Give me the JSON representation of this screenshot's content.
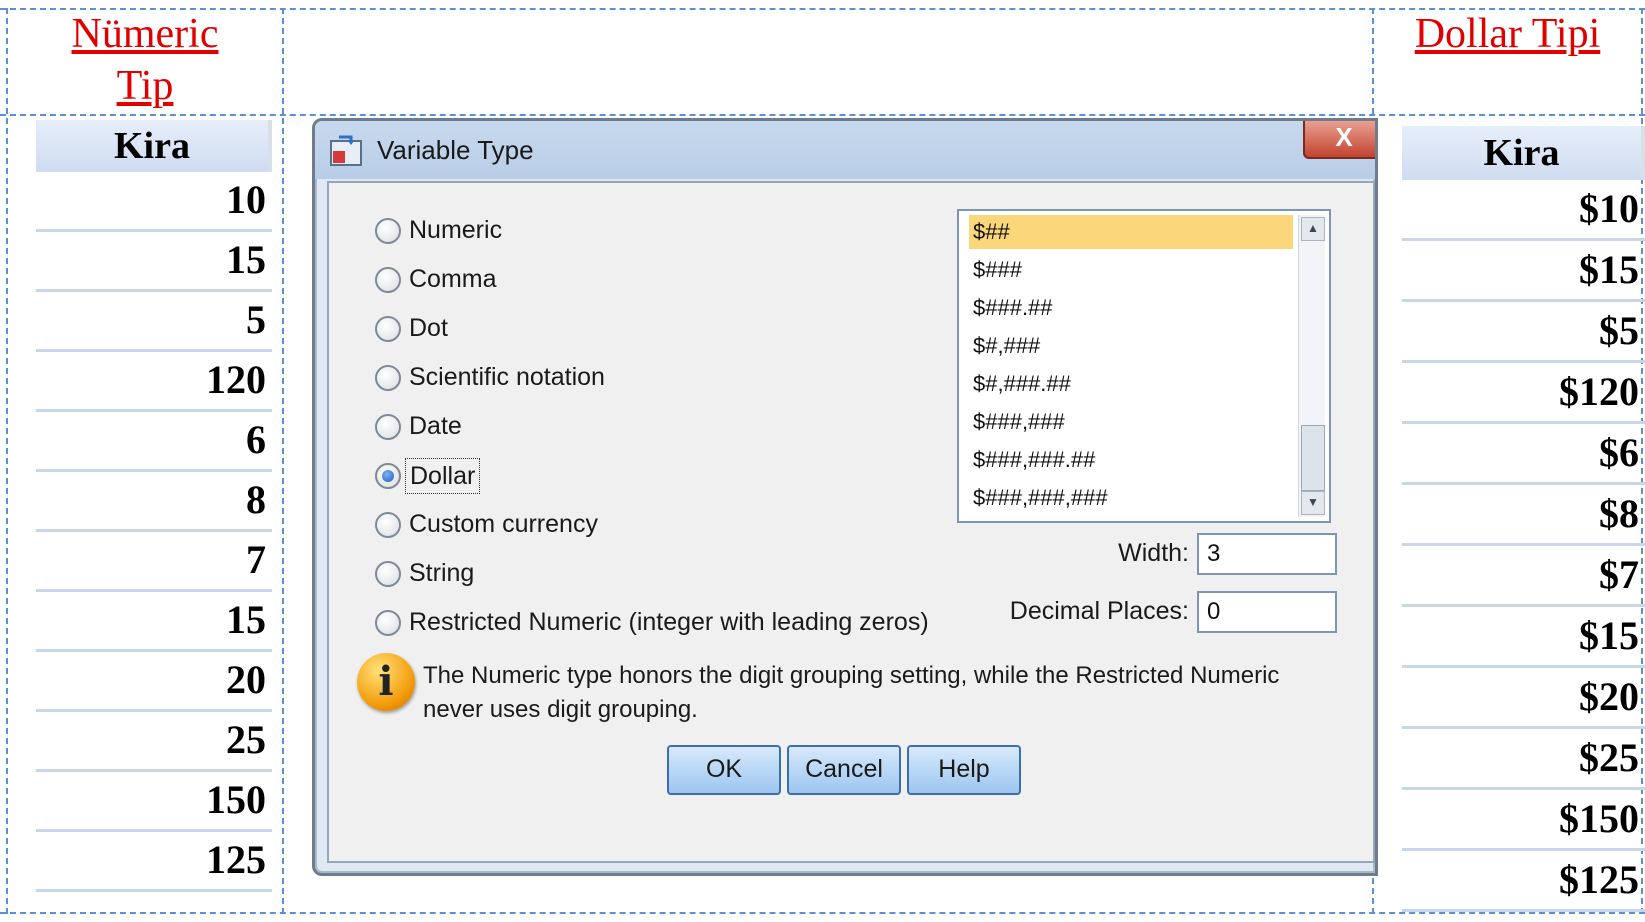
{
  "left_column": {
    "heading_line1": "Nümeric",
    "heading_line2": "Tip",
    "header": "Kira",
    "rows": [
      "10",
      "15",
      "5",
      "120",
      "6",
      "8",
      "7",
      "15",
      "20",
      "25",
      "150",
      "125"
    ]
  },
  "right_column": {
    "heading": "Dollar Tipi",
    "header": "Kira",
    "rows": [
      "$10",
      "$15",
      "$5",
      "$120",
      "$6",
      "$8",
      "$7",
      "$15",
      "$20",
      "$25",
      "$150",
      "$125"
    ]
  },
  "dialog": {
    "title": "Variable Type",
    "close_label": "X",
    "types": [
      {
        "label": "Numeric",
        "checked": false
      },
      {
        "label": "Comma",
        "checked": false
      },
      {
        "label": "Dot",
        "checked": false
      },
      {
        "label": "Scientific notation",
        "checked": false
      },
      {
        "label": "Date",
        "checked": false
      },
      {
        "label": "Dollar",
        "checked": true
      },
      {
        "label": "Custom currency",
        "checked": false
      },
      {
        "label": "String",
        "checked": false
      },
      {
        "label": "Restricted Numeric (integer with leading zeros)",
        "checked": false
      }
    ],
    "formats": [
      "$##",
      "$###",
      "$###.##",
      "$#,###",
      "$#,###.##",
      "$###,###",
      "$###,###.##",
      "$###,###,###"
    ],
    "selected_format": "$##",
    "width_label": "Width:",
    "width_value": "3",
    "decimal_label": "Decimal Places:",
    "decimal_value": "0",
    "info_icon": "info-icon",
    "info_text": "The Numeric type honors the digit grouping setting, while the Restricted Numeric never uses digit grouping.",
    "buttons": {
      "ok": "OK",
      "cancel": "Cancel",
      "help": "Help"
    }
  }
}
